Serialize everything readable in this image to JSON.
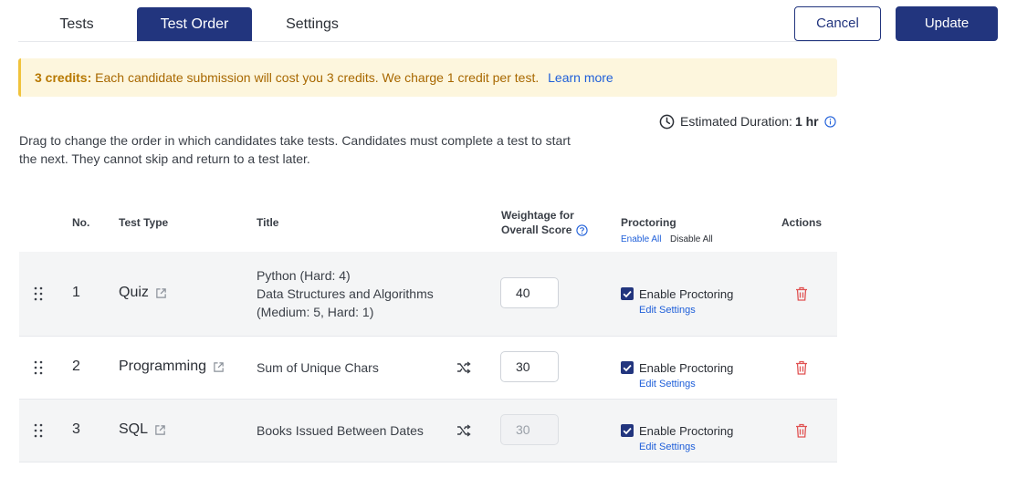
{
  "tabs": [
    {
      "label": "Tests",
      "active": false
    },
    {
      "label": "Test Order",
      "active": true
    },
    {
      "label": "Settings",
      "active": false
    }
  ],
  "actions": {
    "cancel": "Cancel",
    "update": "Update"
  },
  "banner": {
    "bold": "3 credits:",
    "text": "Each candidate submission will cost you 3 credits. We charge 1 credit per test.",
    "link": "Learn more"
  },
  "duration": {
    "label": "Estimated Duration:",
    "value": "1 hr"
  },
  "description": {
    "line1": "Drag to change the order in which candidates take tests. Candidates must complete a test to start",
    "line2": "the next. They cannot skip and return to a test later."
  },
  "table": {
    "headers": {
      "no": "No.",
      "type": "Test Type",
      "title": "Title",
      "weight_line1": "Weightage for",
      "weight_line2": "Overall Score",
      "proctoring": "Proctoring",
      "enable_all": "Enable All",
      "disable_all": "Disable All",
      "actions": "Actions"
    },
    "rows": [
      {
        "no": "1",
        "type": "Quiz",
        "title_lines": [
          "Python (Hard: 4)",
          "Data Structures and Algorithms",
          "(Medium: 5, Hard: 1)"
        ],
        "weight": "40",
        "proctoring_label": "Enable Proctoring",
        "proctoring_checked": true,
        "edit_label": "Edit Settings"
      },
      {
        "no": "2",
        "type": "Programming",
        "title_lines": [
          "Sum of Unique Chars"
        ],
        "weight": "30",
        "proctoring_label": "Enable Proctoring",
        "proctoring_checked": true,
        "edit_label": "Edit Settings"
      },
      {
        "no": "3",
        "type": "SQL",
        "title_lines": [
          "Books Issued Between Dates"
        ],
        "weight": "30",
        "weight_disabled": true,
        "proctoring_label": "Enable Proctoring",
        "proctoring_checked": true,
        "edit_label": "Edit Settings"
      }
    ]
  },
  "colors": {
    "primary": "#22357e",
    "link": "#1f5fd9",
    "banner_bg": "#fdf6dd",
    "banner_border": "#f0c33c",
    "danger": "#e05252"
  }
}
